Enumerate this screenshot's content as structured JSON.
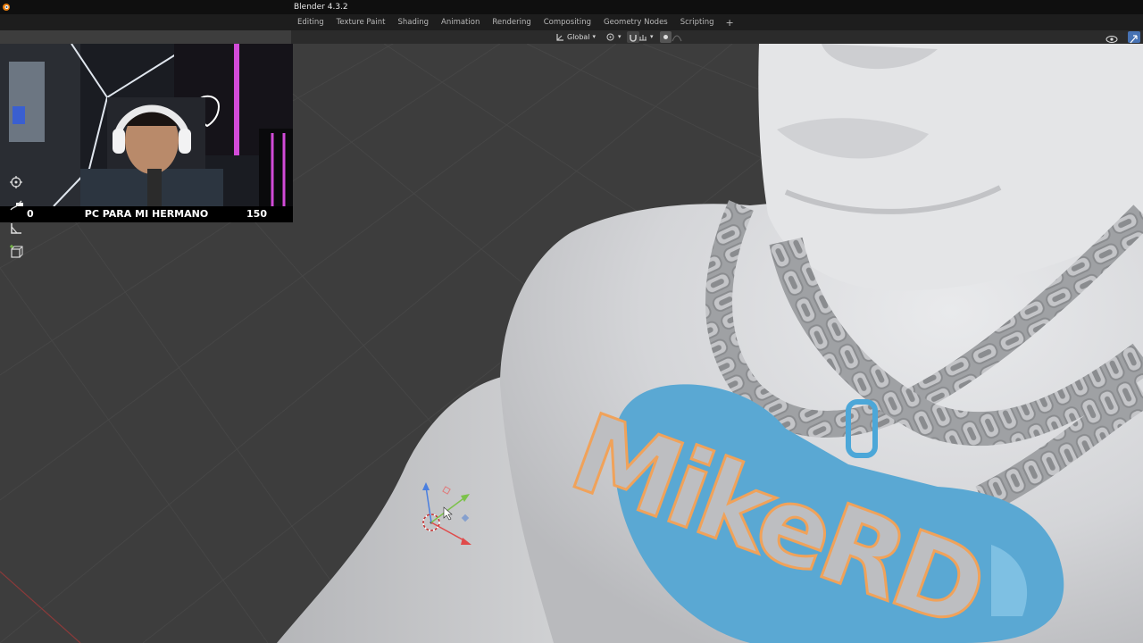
{
  "app": {
    "title": "Blender 4.3.2"
  },
  "workspace_tabs": [
    "Editing",
    "Texture Paint",
    "Shading",
    "Animation",
    "Rendering",
    "Compositing",
    "Geometry Nodes",
    "Scripting"
  ],
  "add_tab_label": "+",
  "header": {
    "transform_orientation": "Global"
  },
  "webcam": {
    "left_value": "0",
    "caption": "PC PARA MI HERMANO",
    "right_value": "150"
  },
  "toolbar": {
    "icons": [
      "transform-icon",
      "annotate-icon",
      "measure-icon",
      "add-cube-icon"
    ]
  },
  "scene": {
    "pendant_text": "MikeRD",
    "pendant_color": "#5aa8d3",
    "outline_color": "#f0a25a",
    "body_color": "#d6d7d9"
  },
  "colors": {
    "viewport_bg": "#3d3d3d",
    "header_bg": "#2b2b2b",
    "menubar_bg": "#1d1d1d",
    "titlebar_bg": "#0f0f0f"
  }
}
